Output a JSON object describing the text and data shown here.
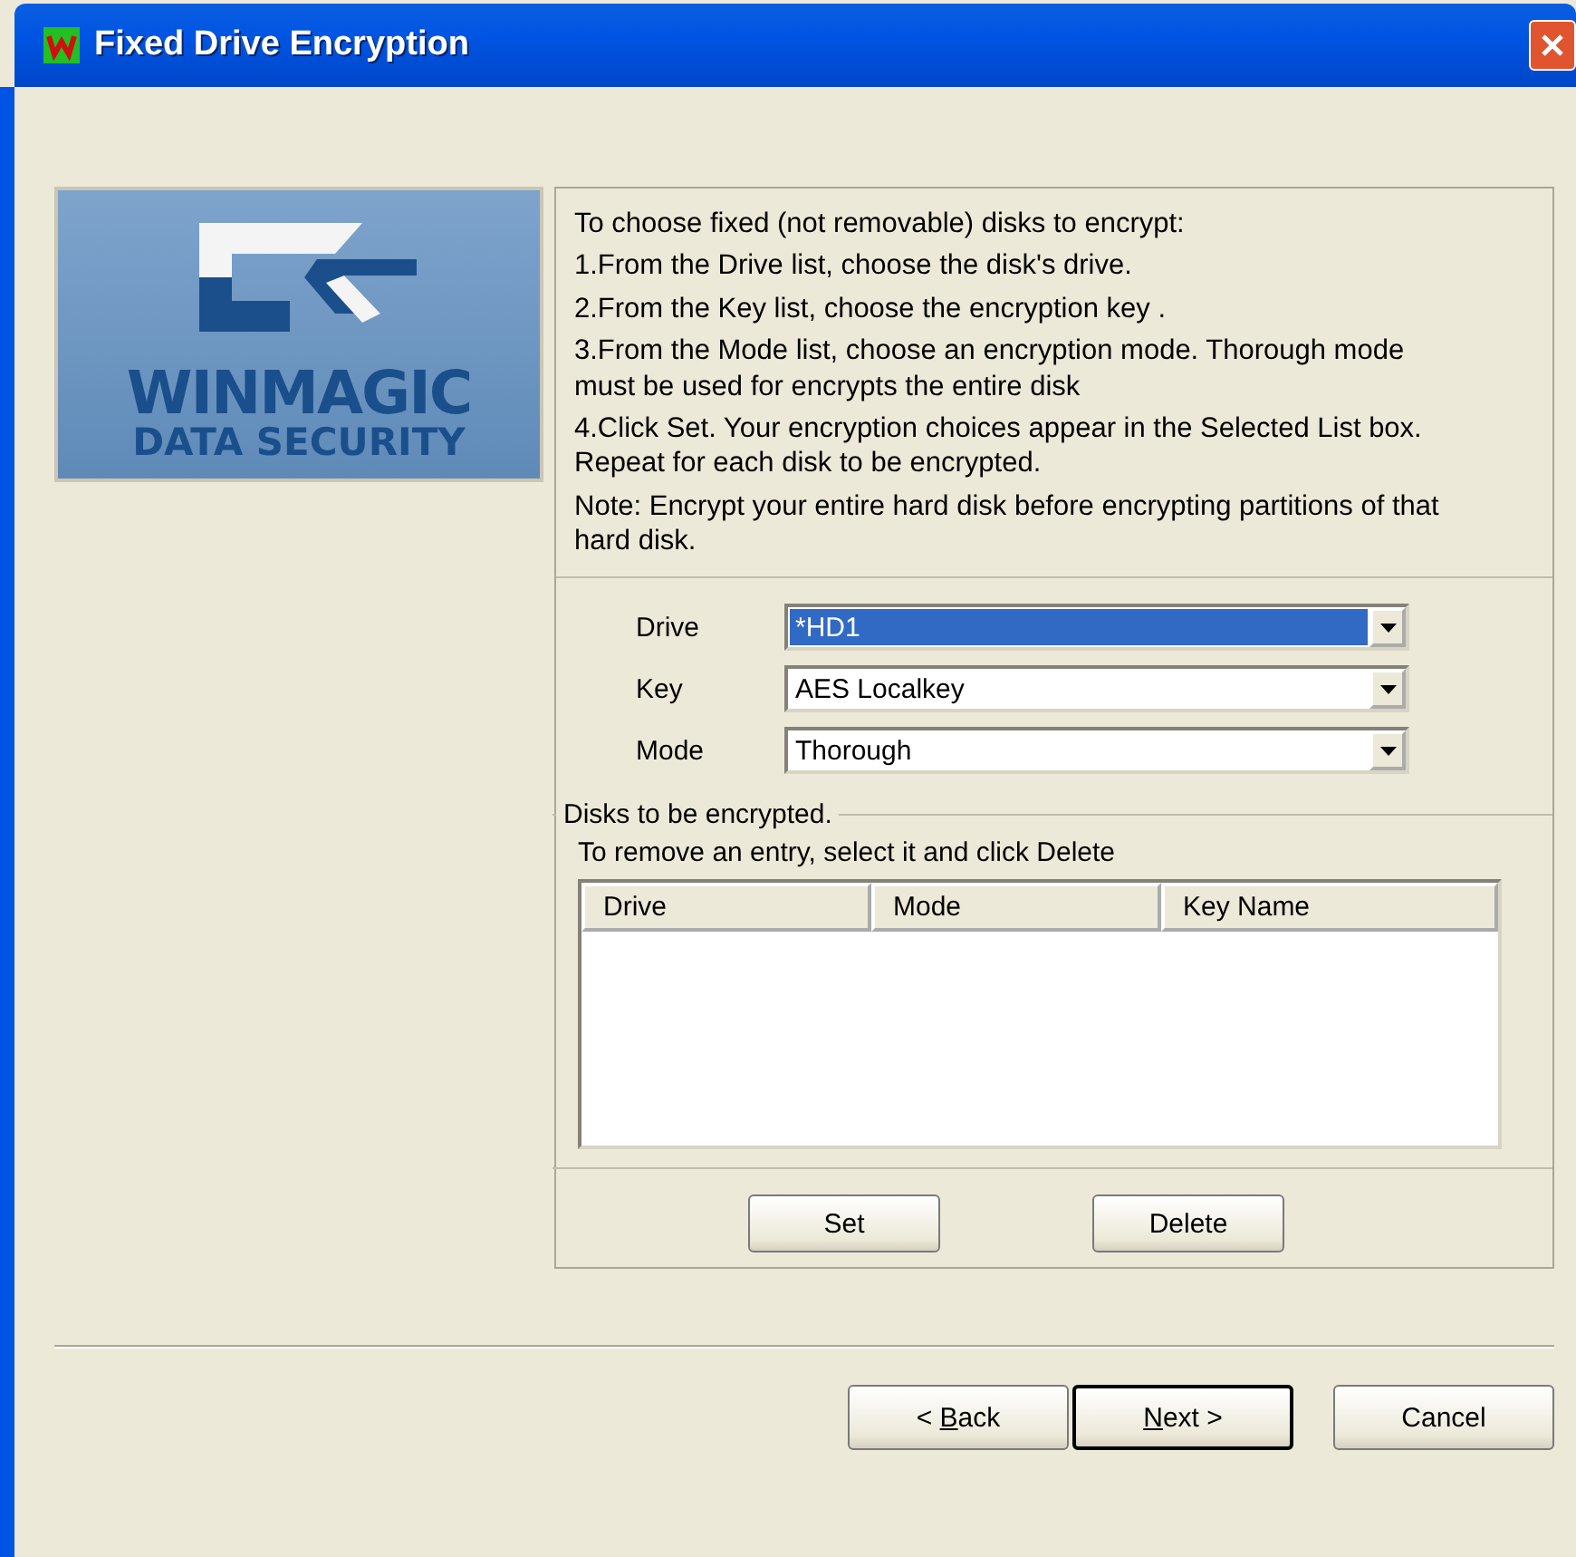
{
  "window": {
    "title": "Fixed Drive Encryption"
  },
  "logo": {
    "line_1": "WINMAGIC",
    "line_2": "DATA SECURITY"
  },
  "instructions": {
    "intro": "To choose fixed (not removable) disks to encrypt:",
    "steps": [
      "1.From the Drive list, choose the disk's drive.",
      "2.From the Key list, choose the encryption key .",
      "3.From the Mode list, choose an encryption mode. Thorough mode must be used for encrypts the entire disk",
      "4.Click Set. Your encryption choices appear in the Selected List box.   Repeat for each disk to be encrypted."
    ],
    "note": "Note: Encrypt your entire hard disk before encrypting partitions of that hard disk."
  },
  "fields": [
    {
      "label": "Drive",
      "value": "*HD1",
      "focused": true
    },
    {
      "label": "Key",
      "value": "AES  Localkey",
      "focused": false
    },
    {
      "label": "Mode",
      "value": "Thorough",
      "focused": false
    }
  ],
  "disks_group": {
    "title": "Disks to be encrypted.",
    "hint": "To remove an entry, select it and click Delete",
    "columns": [
      "Drive",
      "Mode",
      "Key Name"
    ],
    "buttons": [
      "Set",
      "Delete"
    ]
  },
  "footer_buttons": [
    {
      "before": "< ",
      "mnemonic": "B",
      "after": "ack",
      "default": false
    },
    {
      "mnemonic": "N",
      "after": "ext >",
      "default": true
    },
    {
      "before": "Cancel",
      "default": false
    }
  ]
}
